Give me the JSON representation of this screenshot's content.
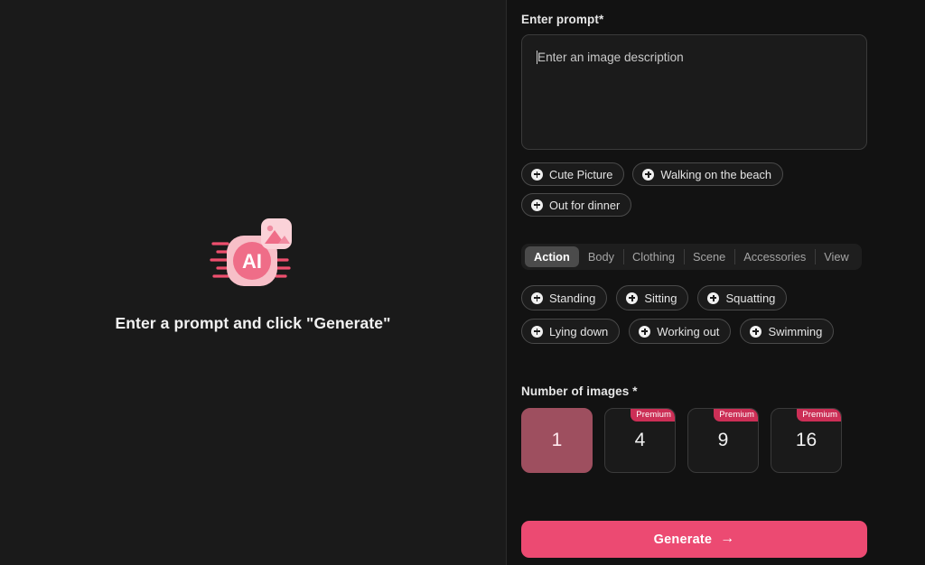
{
  "preview": {
    "icon_name": "ai-image-generator-icon",
    "placeholder_title": "Enter a prompt and click \"Generate\"",
    "icon_colors": {
      "light_pink": "#f8c0c8",
      "mid_pink": "#f07f95",
      "accent_pink": "#ee4f6e",
      "card_pink": "#fbd2d8"
    }
  },
  "form": {
    "prompt": {
      "label": "Enter prompt*",
      "value": "",
      "placeholder": "Enter an image description"
    },
    "suggestions": [
      {
        "label": "Cute Picture"
      },
      {
        "label": "Walking on the beach"
      },
      {
        "label": "Out for dinner"
      }
    ],
    "tabs": [
      {
        "label": "Action",
        "active": true
      },
      {
        "label": "Body",
        "active": false
      },
      {
        "label": "Clothing",
        "active": false
      },
      {
        "label": "Scene",
        "active": false
      },
      {
        "label": "Accessories",
        "active": false
      },
      {
        "label": "View",
        "active": false
      }
    ],
    "options": [
      {
        "label": "Standing"
      },
      {
        "label": "Sitting"
      },
      {
        "label": "Squatting"
      },
      {
        "label": "Lying down"
      },
      {
        "label": "Working out"
      },
      {
        "label": "Swimming"
      }
    ],
    "number_of_images": {
      "label": "Number of images *",
      "badge_label": "Premium",
      "choices": [
        {
          "value": "1",
          "premium": false,
          "selected": true
        },
        {
          "value": "4",
          "premium": true,
          "selected": false
        },
        {
          "value": "9",
          "premium": true,
          "selected": false
        },
        {
          "value": "16",
          "premium": true,
          "selected": false
        }
      ]
    },
    "generate": {
      "label": "Generate",
      "arrow": "→"
    },
    "colors": {
      "accent": "#ec4a72",
      "premium_badge": "#cc2f56",
      "selected_card": "#9e4f5f",
      "panel_bg": "#121212",
      "preview_bg": "#1a1a1a"
    }
  }
}
